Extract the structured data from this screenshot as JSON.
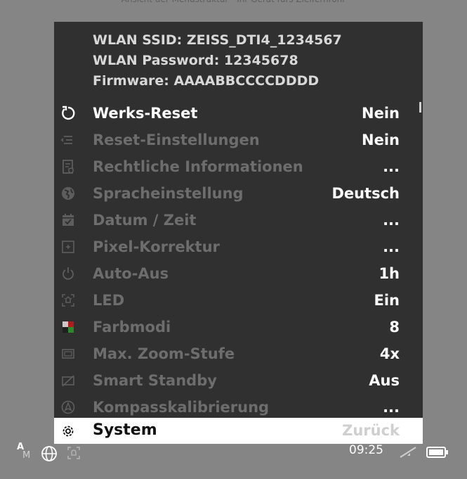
{
  "top_hint": "Ansicht der Menüstruktur - Ihr Gerät fürs Zielfernrohr",
  "info": {
    "ssid": "WLAN SSID: ZEISS_DTI4_1234567",
    "password": "WLAN Password: 12345678",
    "firmware": "Firmware: AAAABBCCCCDDDD"
  },
  "menu": [
    {
      "label": "Werks-Reset",
      "value": "Nein",
      "icon": "reset-icon",
      "active": true
    },
    {
      "label": "Reset-Einstellungen",
      "value": "Nein",
      "icon": "reset-settings-icon"
    },
    {
      "label": "Rechtliche Informationen",
      "value": "...",
      "icon": "legal-document-icon"
    },
    {
      "label": "Spracheinstellung",
      "value": "Deutsch",
      "icon": "globe-icon"
    },
    {
      "label": "Datum / Zeit",
      "value": "...",
      "icon": "calendar-icon"
    },
    {
      "label": "Pixel-Korrektur",
      "value": "...",
      "icon": "pixel-correction-icon"
    },
    {
      "label": "Auto-Aus",
      "value": "1h",
      "icon": "power-icon"
    },
    {
      "label": "LED",
      "value": "Ein",
      "icon": "led-icon"
    },
    {
      "label": "Farbmodi",
      "value": "8",
      "icon": "color-modes-icon"
    },
    {
      "label": "Max. Zoom-Stufe",
      "value": "4x",
      "icon": "zoom-level-icon"
    },
    {
      "label": "Smart Standby",
      "value": "Aus",
      "icon": "smart-standby-icon"
    },
    {
      "label": "Kompasskalibrierung",
      "value": "...",
      "icon": "compass-icon"
    }
  ],
  "footer": {
    "label": "System",
    "back": "Zurück",
    "icon": "gear-icon"
  },
  "status": {
    "mode_top": "A",
    "mode_bottom": "M",
    "time": "09:25"
  },
  "colors": {
    "background": "#858585",
    "panel": "#303030",
    "active_text": "#ffffff",
    "dim_text": "#6d6d6d",
    "footer_bg": "#ffffff"
  }
}
